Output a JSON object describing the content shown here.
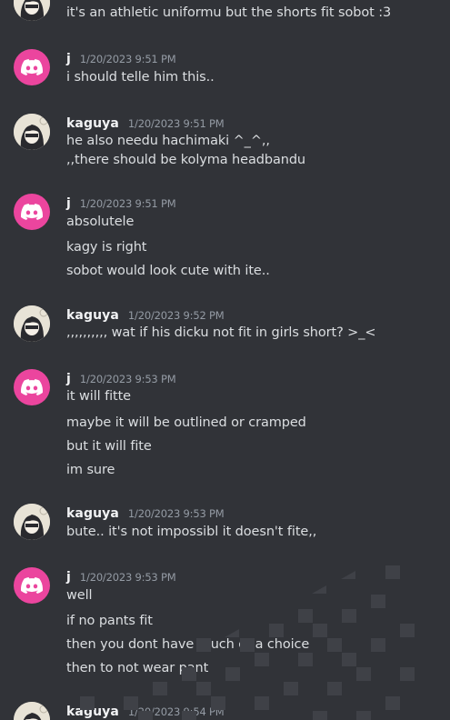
{
  "messages": [
    {
      "id": "m0",
      "author": "kaguya",
      "avatar": "kaguya-avatar",
      "timestamp": "",
      "lines": [
        "it's an athletic uniformu but the shorts fit sobot :3"
      ]
    },
    {
      "id": "m1",
      "author": "j",
      "avatar": "discord-default-avatar",
      "timestamp": "1/20/2023 9:51 PM",
      "lines": [
        "i should telle him this.."
      ]
    },
    {
      "id": "m2",
      "author": "kaguya",
      "avatar": "kaguya-avatar",
      "timestamp": "1/20/2023 9:51 PM",
      "lines": [
        "he also needu hachimaki ^_^,,",
        ",,there should be kolyma headbandu"
      ]
    },
    {
      "id": "m3",
      "author": "j",
      "avatar": "discord-default-avatar",
      "timestamp": "1/20/2023 9:51 PM",
      "lines": [
        "absolutele",
        "kagy is right",
        "sobot would look cute with ite.."
      ]
    },
    {
      "id": "m4",
      "author": "kaguya",
      "avatar": "kaguya-avatar",
      "timestamp": "1/20/2023 9:52 PM",
      "lines": [
        ",,,,,,,,,, wat if his dicku not fit in girls short? >_<"
      ]
    },
    {
      "id": "m5",
      "author": "j",
      "avatar": "discord-default-avatar",
      "timestamp": "1/20/2023 9:53 PM",
      "lines": [
        "it will fitte",
        "maybe it will be outlined or cramped",
        "but it will fite",
        "im sure"
      ]
    },
    {
      "id": "m6",
      "author": "kaguya",
      "avatar": "kaguya-avatar",
      "timestamp": "1/20/2023 9:53 PM",
      "lines": [
        "bute.. it's not impossibl it doesn't fite,,"
      ]
    },
    {
      "id": "m7",
      "author": "j",
      "avatar": "discord-default-avatar",
      "timestamp": "1/20/2023 9:53 PM",
      "lines": [
        "well",
        "if no pants fit",
        "then you dont have much of a choice",
        "then to not wear pant"
      ]
    },
    {
      "id": "m8",
      "author": "kaguya",
      "avatar": "kaguya-avatar",
      "timestamp": "1/20/2023 9:54 PM",
      "lines": []
    }
  ],
  "colors": {
    "background": "#313338",
    "discord_avatar": "#eb459e",
    "author": "#f2f3f5",
    "timestamp": "#949ba4",
    "text": "#dbdee1"
  }
}
